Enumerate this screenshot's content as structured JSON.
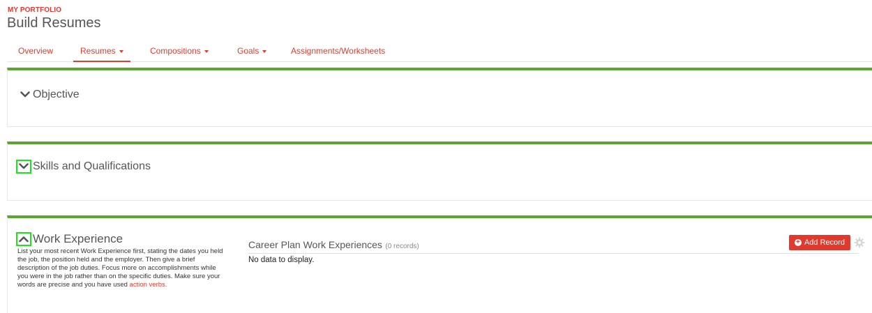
{
  "header": {
    "eyebrow": "MY PORTFOLIO",
    "title": "Build Resumes"
  },
  "tabs": [
    {
      "label": "Overview",
      "dropdown": false,
      "active": false
    },
    {
      "label": "Resumes",
      "dropdown": true,
      "active": true
    },
    {
      "label": "Compositions",
      "dropdown": true,
      "active": false
    },
    {
      "label": "Goals",
      "dropdown": true,
      "active": false
    },
    {
      "label": "Assignments/Worksheets",
      "dropdown": false,
      "active": false
    }
  ],
  "sections": {
    "objective": {
      "title": "Objective",
      "icon": "chevron-down-icon"
    },
    "skills": {
      "title": "Skills and Qualifications",
      "icon": "chevron-down-icon"
    },
    "work": {
      "title": "Work Experience",
      "icon": "chevron-up-icon",
      "description": "List your most recent Work Experience first, stating the dates you held the job, the position held and the employer. Then give a brief description of the job duties. Focus more on accomplishments while you were in the job rather than on the specific duties. Make sure your words are precise and you have used",
      "link_text": "action verbs.",
      "records_title": "Career Plan Work Experiences",
      "records_count": "(0 records)",
      "empty_text": "No data to display.",
      "add_button": "Add Record"
    }
  },
  "colors": {
    "accent": "#e03a2f",
    "panel_border": "#5aa62e",
    "highlight": "#19e619"
  }
}
